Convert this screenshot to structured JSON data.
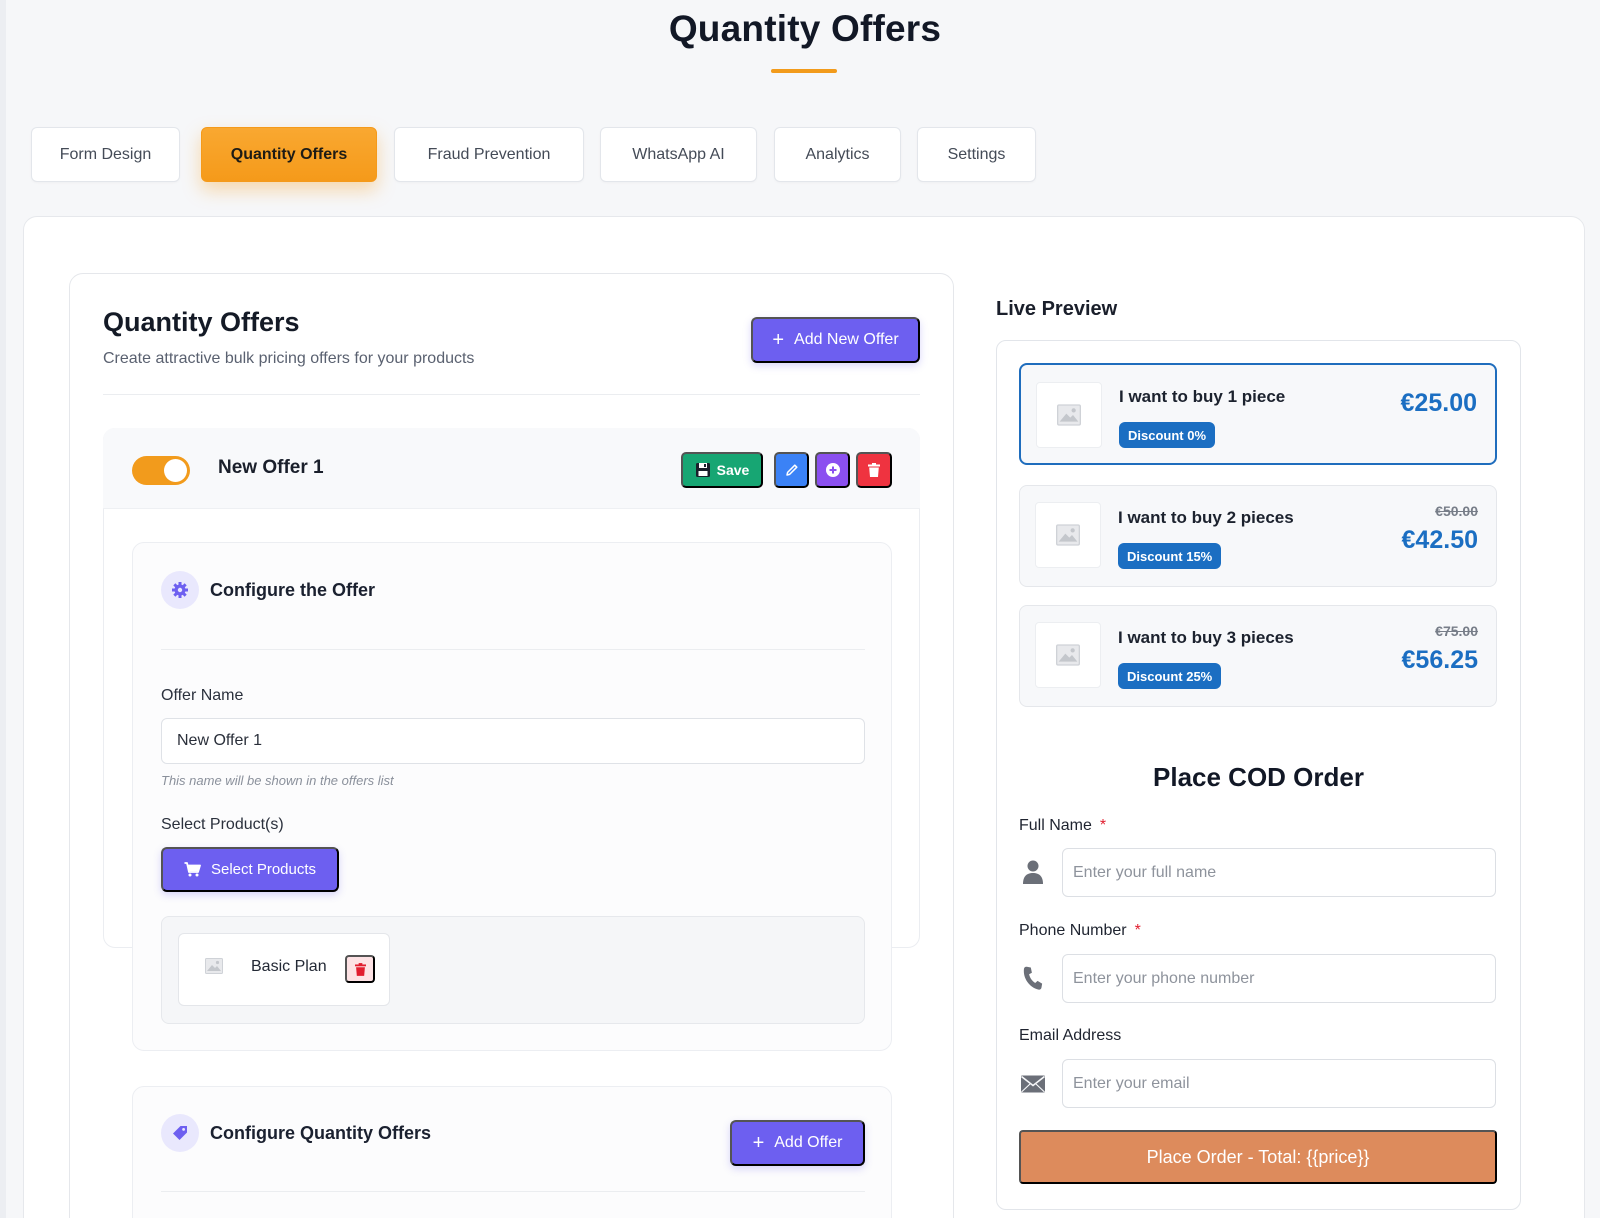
{
  "page": {
    "title": "Quantity Offers"
  },
  "tabs": [
    {
      "label": "Form Design",
      "active": false
    },
    {
      "label": "Quantity Offers",
      "active": true
    },
    {
      "label": "Fraud Prevention",
      "active": false
    },
    {
      "label": "WhatsApp AI",
      "active": false
    },
    {
      "label": "Analytics",
      "active": false
    },
    {
      "label": "Settings",
      "active": false
    }
  ],
  "offers_panel": {
    "title": "Quantity Offers",
    "subtitle": "Create attractive bulk pricing offers for your products",
    "add_new_offer_label": "Add New Offer",
    "offer": {
      "name": "New Offer 1",
      "enabled": true,
      "save_label": "Save"
    },
    "configure": {
      "title": "Configure the Offer",
      "offer_name_label": "Offer Name",
      "offer_name_value": "New Offer 1",
      "offer_name_hint": "This name will be shown in the offers list",
      "select_products_label": "Select Product(s)",
      "select_products_button": "Select Products",
      "products": [
        {
          "name": "Basic Plan"
        }
      ]
    },
    "quantity": {
      "title": "Configure Quantity Offers",
      "add_offer_label": "Add Offer"
    }
  },
  "preview": {
    "title": "Live Preview",
    "offers": [
      {
        "text": "I want to buy 1 piece",
        "discount": "Discount 0%",
        "price": "€25.00",
        "old_price": "",
        "selected": true
      },
      {
        "text": "I want to buy 2 pieces",
        "discount": "Discount 15%",
        "price": "€42.50",
        "old_price": "€50.00",
        "selected": false
      },
      {
        "text": "I want to buy 3 pieces",
        "discount": "Discount 25%",
        "price": "€56.25",
        "old_price": "€75.00",
        "selected": false
      }
    ],
    "form": {
      "title": "Place COD Order",
      "full_name_label": "Full Name",
      "full_name_placeholder": "Enter your full name",
      "phone_label": "Phone Number",
      "phone_placeholder": "Enter your phone number",
      "email_label": "Email Address",
      "email_placeholder": "Enter your email",
      "required_mark": "*",
      "submit_label": "Place Order - Total: {{price}}"
    }
  },
  "colors": {
    "accent_orange": "#f29b1c",
    "primary_purple": "#6d5ff0",
    "save_green": "#17a673",
    "edit_blue": "#3b82f6",
    "add_purple": "#8b50f0",
    "delete_red": "#ef3340",
    "price_blue": "#1b6ec2",
    "order_button": "#dd8b5c"
  },
  "icons": {
    "save": "floppy-disk-icon",
    "edit": "pencil-icon",
    "add": "plus-circle-icon",
    "delete": "trash-icon",
    "configure": "gear-icon",
    "quantity": "tag-icon",
    "cart": "cart-icon",
    "image": "image-placeholder-icon",
    "user": "user-icon",
    "phone": "phone-icon",
    "email": "envelope-icon"
  }
}
